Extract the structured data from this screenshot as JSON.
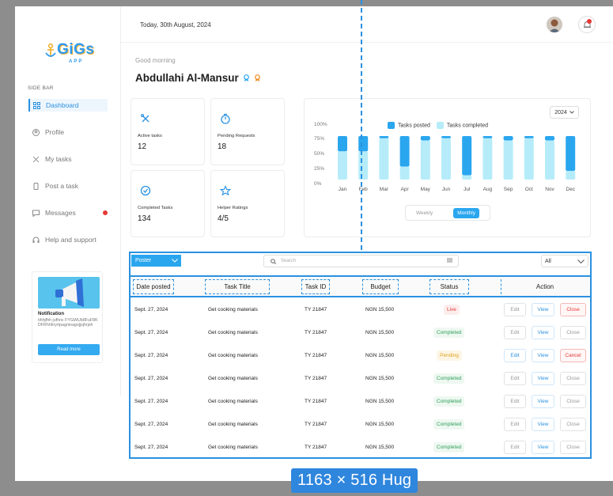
{
  "header": {
    "date": "Today, 30th August, 2024"
  },
  "logo": {
    "word": "GiGs",
    "sub": "APP"
  },
  "sidebar": {
    "label": "SIDE BAR",
    "items": [
      {
        "label": "Dashboard",
        "icon": "grid-icon",
        "active": true
      },
      {
        "label": "Profile",
        "icon": "user-icon"
      },
      {
        "label": "My tasks",
        "icon": "tools-icon"
      },
      {
        "label": "Post a task",
        "icon": "document-icon"
      },
      {
        "label": "Messages",
        "icon": "chat-icon",
        "badge": true
      },
      {
        "label": "Help and support",
        "icon": "headset-icon"
      }
    ],
    "notification": {
      "title": "Notification",
      "text": "tihhjfhh jufhnc FYGWUb8FuF8K DFRhhfnyrtpagnioagojjsjhrjsh",
      "button": "Read more"
    }
  },
  "greeting": {
    "salutation": "Good morning",
    "name": "Abdullahi Al-Mansur"
  },
  "stats": [
    {
      "label": "Active tasks",
      "value": "12",
      "icon": "tools-icon"
    },
    {
      "label": "Pending Requests",
      "value": "18",
      "icon": "timer-icon"
    },
    {
      "label": "Completed Tasks",
      "value": "134",
      "icon": "check-badge-icon"
    },
    {
      "label": "Helper Ratings",
      "value": "4/5",
      "icon": "star-icon"
    }
  ],
  "chart": {
    "year": "2024",
    "toggle": {
      "weekly": "Weekly",
      "monthly": "Monthly",
      "selected": "Monthly"
    }
  },
  "chart_data": {
    "type": "bar",
    "categories": [
      "Jan",
      "Feb",
      "Mar",
      "Apr",
      "May",
      "Jun",
      "Jul",
      "Aug",
      "Sep",
      "Oct",
      "Nov",
      "Dec"
    ],
    "series": [
      {
        "name": "Tasks posted",
        "color": "#2aa6ef",
        "values": [
          35,
          35,
          5,
          70,
          10,
          5,
          90,
          5,
          10,
          5,
          10,
          80
        ]
      },
      {
        "name": "Tasks completed",
        "color": "#b6ecf9",
        "values": [
          65,
          65,
          95,
          30,
          90,
          95,
          10,
          95,
          90,
          95,
          90,
          20
        ]
      }
    ],
    "stacked": true,
    "ylim": [
      0,
      100
    ],
    "yticks": [
      "100%",
      "75%",
      "50%",
      "25%",
      "0%"
    ],
    "legend": "top"
  },
  "table": {
    "poster": "Poster",
    "search_placeholder": "Search",
    "filter": "All",
    "headers": [
      "Date posted",
      "Task Title",
      "Task ID",
      "Budget",
      "Status",
      "Action"
    ],
    "actions": {
      "edit": "Edit",
      "view": "View",
      "close": "Close",
      "cancel": "Cancel"
    },
    "rows": [
      {
        "date": "Sept. 27, 2024",
        "title": "Get cooking materials",
        "id": "TY 21847",
        "budget": "NGN 15,500",
        "status": "Live"
      },
      {
        "date": "Sept. 27, 2024",
        "title": "Get cooking materials",
        "id": "TY 21847",
        "budget": "NGN 15,500",
        "status": "Completed"
      },
      {
        "date": "Sept. 27, 2024",
        "title": "Get cooking materials",
        "id": "TY 21847",
        "budget": "NGN 15,500",
        "status": "Pending"
      },
      {
        "date": "Sept. 27, 2024",
        "title": "Get cooking materials",
        "id": "TY 21847",
        "budget": "NGN 15,500",
        "status": "Completed"
      },
      {
        "date": "Sept. 27, 2024",
        "title": "Get cooking materials",
        "id": "TY 21847",
        "budget": "NGN 15,500",
        "status": "Completed"
      },
      {
        "date": "Sept. 27, 2024",
        "title": "Get cooking materials",
        "id": "TY 21847",
        "budget": "NGN 15,500",
        "status": "Completed"
      },
      {
        "date": "Sept. 27, 2024",
        "title": "Get cooking materials",
        "id": "TY 21847",
        "budget": "NGN 15,500",
        "status": "Completed"
      }
    ]
  },
  "size_badge": "1163 × 516 Hug"
}
